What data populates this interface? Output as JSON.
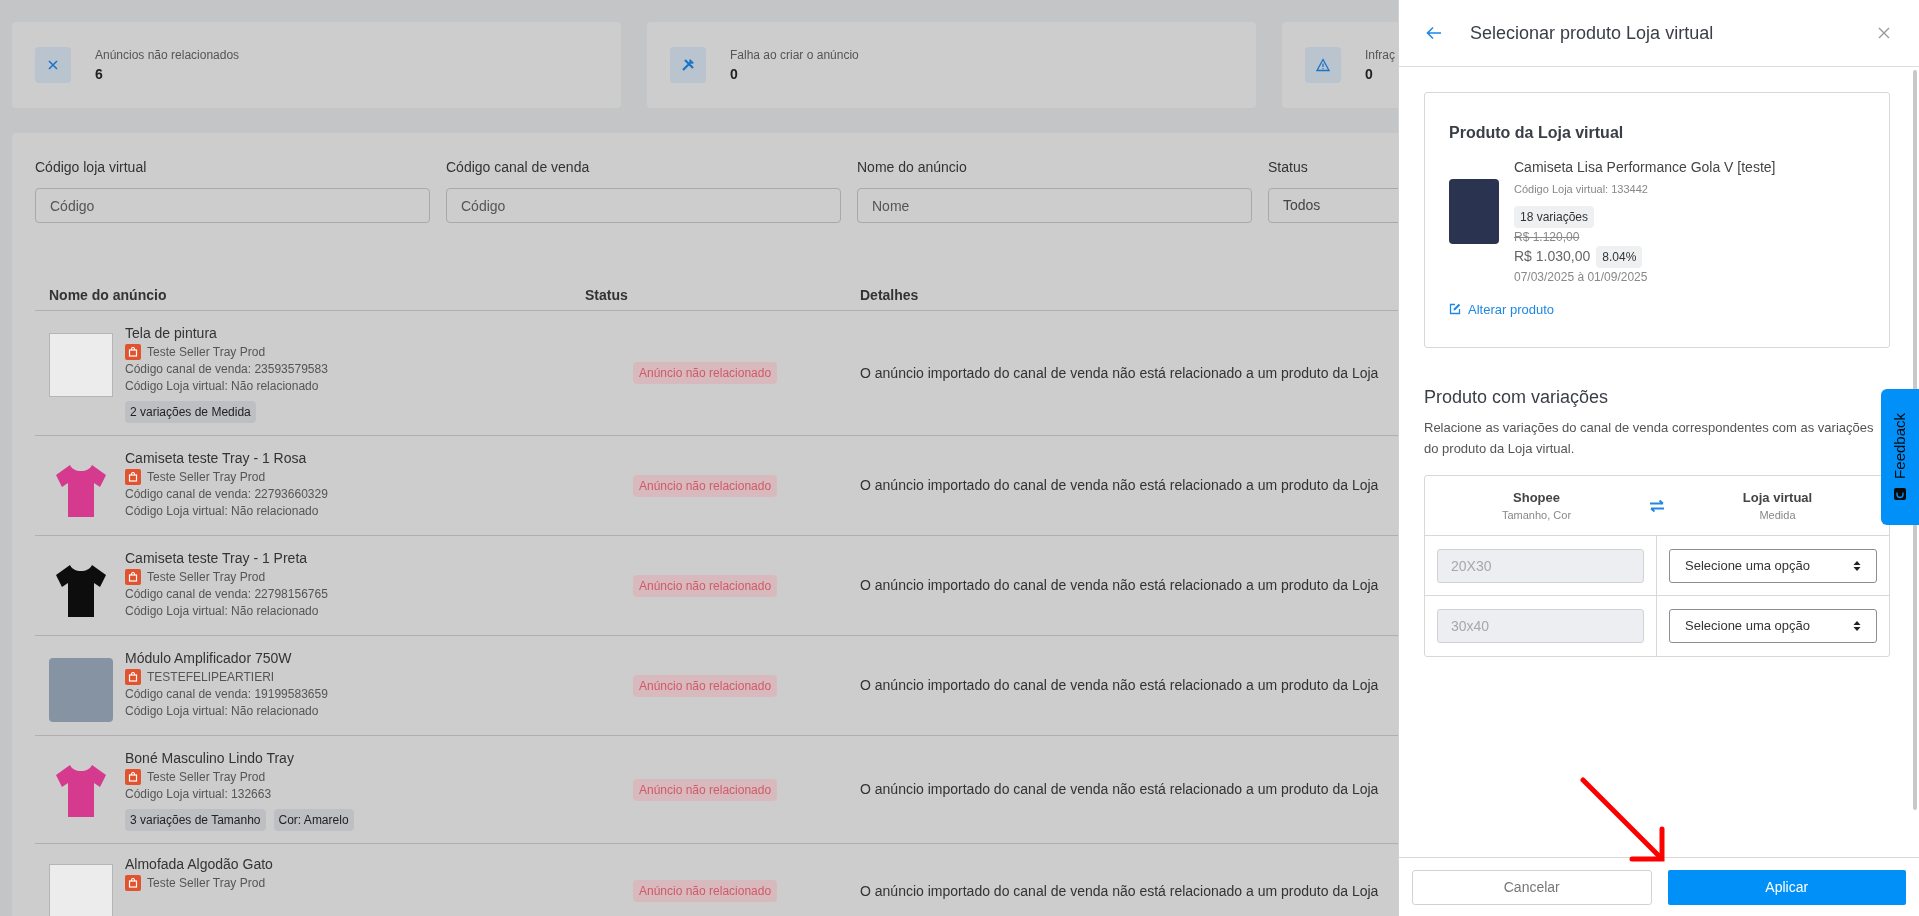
{
  "summary_cards": [
    {
      "kind": "unlinked",
      "label": "Anúncios não relacionados",
      "count": "6"
    },
    {
      "kind": "failure",
      "label": "Falha ao criar o anúncio",
      "count": "0"
    },
    {
      "kind": "infraction",
      "label": "Infraç",
      "count": "0"
    }
  ],
  "filters": [
    {
      "kind": "input",
      "label": "Código loja virtual",
      "placeholder": "Código"
    },
    {
      "kind": "input",
      "label": "Código canal de venda",
      "placeholder": "Código"
    },
    {
      "kind": "input",
      "label": "Nome do anúncio",
      "placeholder": "Nome"
    },
    {
      "kind": "select",
      "label": "Status",
      "value": "Todos"
    }
  ],
  "table": {
    "columns": [
      "Nome do anúncio",
      "Status",
      "Detalhes"
    ],
    "rows": [
      {
        "kind": "text-image",
        "title": "Tela de pintura",
        "shop": "Teste Seller Tray Prod",
        "lines": [
          "Código canal de venda: 23593579583",
          "Código Loja virtual: Não relacionado"
        ],
        "tags": [
          "2 variações de Medida"
        ],
        "status": "Anúncio não relacionado",
        "details": "O anúncio importado do canal de venda não está relacionado a um produto da Loja"
      },
      {
        "kind": "pink-shirt",
        "title": "Camiseta teste Tray - 1 Rosa",
        "shop": "Teste Seller Tray Prod",
        "lines": [
          "Código canal de venda: 22793660329",
          "Código Loja virtual: Não relacionado"
        ],
        "status": "Anúncio não relacionado",
        "details": "O anúncio importado do canal de venda não está relacionado a um produto da Loja"
      },
      {
        "kind": "black-shirt",
        "title": "Camiseta teste Tray - 1 Preta",
        "shop": "Teste Seller Tray Prod",
        "lines": [
          "Código canal de venda: 22798156765",
          "Código Loja virtual: Não relacionado"
        ],
        "status": "Anúncio não relacionado",
        "details": "O anúncio importado do canal de venda não está relacionado a um produto da Loja"
      },
      {
        "kind": "photo",
        "title": "Módulo Amplificador 750W",
        "shop": "TESTEFELIPEARTIERI",
        "lines": [
          "Código canal de venda: 19199583659",
          "Código Loja virtual: Não relacionado"
        ],
        "status": "Anúncio não relacionado",
        "details": "O anúncio importado do canal de venda não está relacionado a um produto da Loja"
      },
      {
        "kind": "pink-shirt",
        "title": "Boné Masculino Lindo Tray",
        "shop": "Teste Seller Tray Prod",
        "lines": [
          "Código Loja virtual: 132663"
        ],
        "tags": [
          "3 variações de Tamanho",
          "Cor: Amarelo"
        ],
        "status": "Anúncio não relacionado",
        "details": "O anúncio importado do canal de venda não está relacionado a um produto da Loja"
      },
      {
        "kind": "text-image",
        "title": "Almofada Algodão Gato",
        "shop": "Teste Seller Tray Prod",
        "lines": [],
        "status": "Anúncio não relacionado",
        "details": "O anúncio importado do canal de venda não está relacionado a um produto da Loja"
      }
    ]
  },
  "drawer": {
    "title": "Selecionar produto Loja virtual",
    "product": {
      "heading": "Produto da Loja virtual",
      "name": "Camiseta Lisa Performance Gola V [teste]",
      "code": "Código Loja virtual: 133442",
      "variations": "18 variações",
      "old_price": "R$ 1.120,00",
      "price": "R$ 1.030,00",
      "discount": "8.04%",
      "dates": "07/03/2025 à 01/09/2025",
      "change_link": "Alterar produto"
    },
    "variations": {
      "heading": "Produto com variações",
      "description": "Relacione as variações do canal de venda correspondentes com as variações do produto da Loja virtual.",
      "source": {
        "name": "Shopee",
        "attributes": "Tamanho, Cor"
      },
      "target": {
        "name": "Loja virtual",
        "attributes": "Medida"
      },
      "rows": [
        {
          "source_value": "20X30",
          "disabled": true,
          "target_value": "Selecione uma opção"
        },
        {
          "source_value": "30x40",
          "disabled": true,
          "target_value": "Selecione uma opção"
        }
      ]
    },
    "buttons": {
      "cancel": "Cancelar",
      "apply": "Aplicar"
    }
  },
  "feedback_tab": "Feedback"
}
